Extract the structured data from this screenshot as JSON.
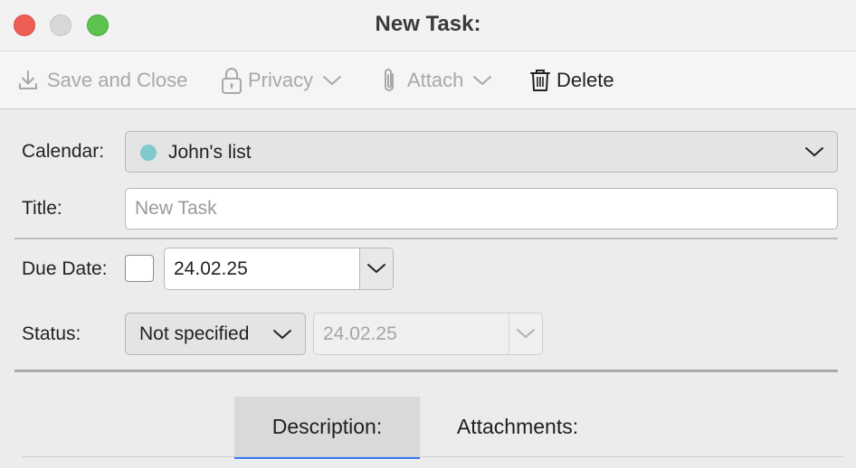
{
  "window": {
    "title": "New Task:"
  },
  "toolbar": {
    "save_label": "Save and Close",
    "privacy_label": "Privacy",
    "attach_label": "Attach",
    "delete_label": "Delete"
  },
  "form": {
    "calendar_label": "Calendar:",
    "calendar_value": "John's list",
    "calendar_color": "#7ecacd",
    "title_label": "Title:",
    "title_placeholder": "New Task",
    "due_date_label": "Due Date:",
    "due_date_value": "24.02.25",
    "status_label": "Status:",
    "status_value": "Not specified",
    "status_date_value": "24.02.25"
  },
  "tabs": [
    {
      "label": "Description:",
      "selected": true
    },
    {
      "label": "Attachments:",
      "selected": false
    }
  ],
  "colors": {
    "accent": "#3478f6"
  }
}
